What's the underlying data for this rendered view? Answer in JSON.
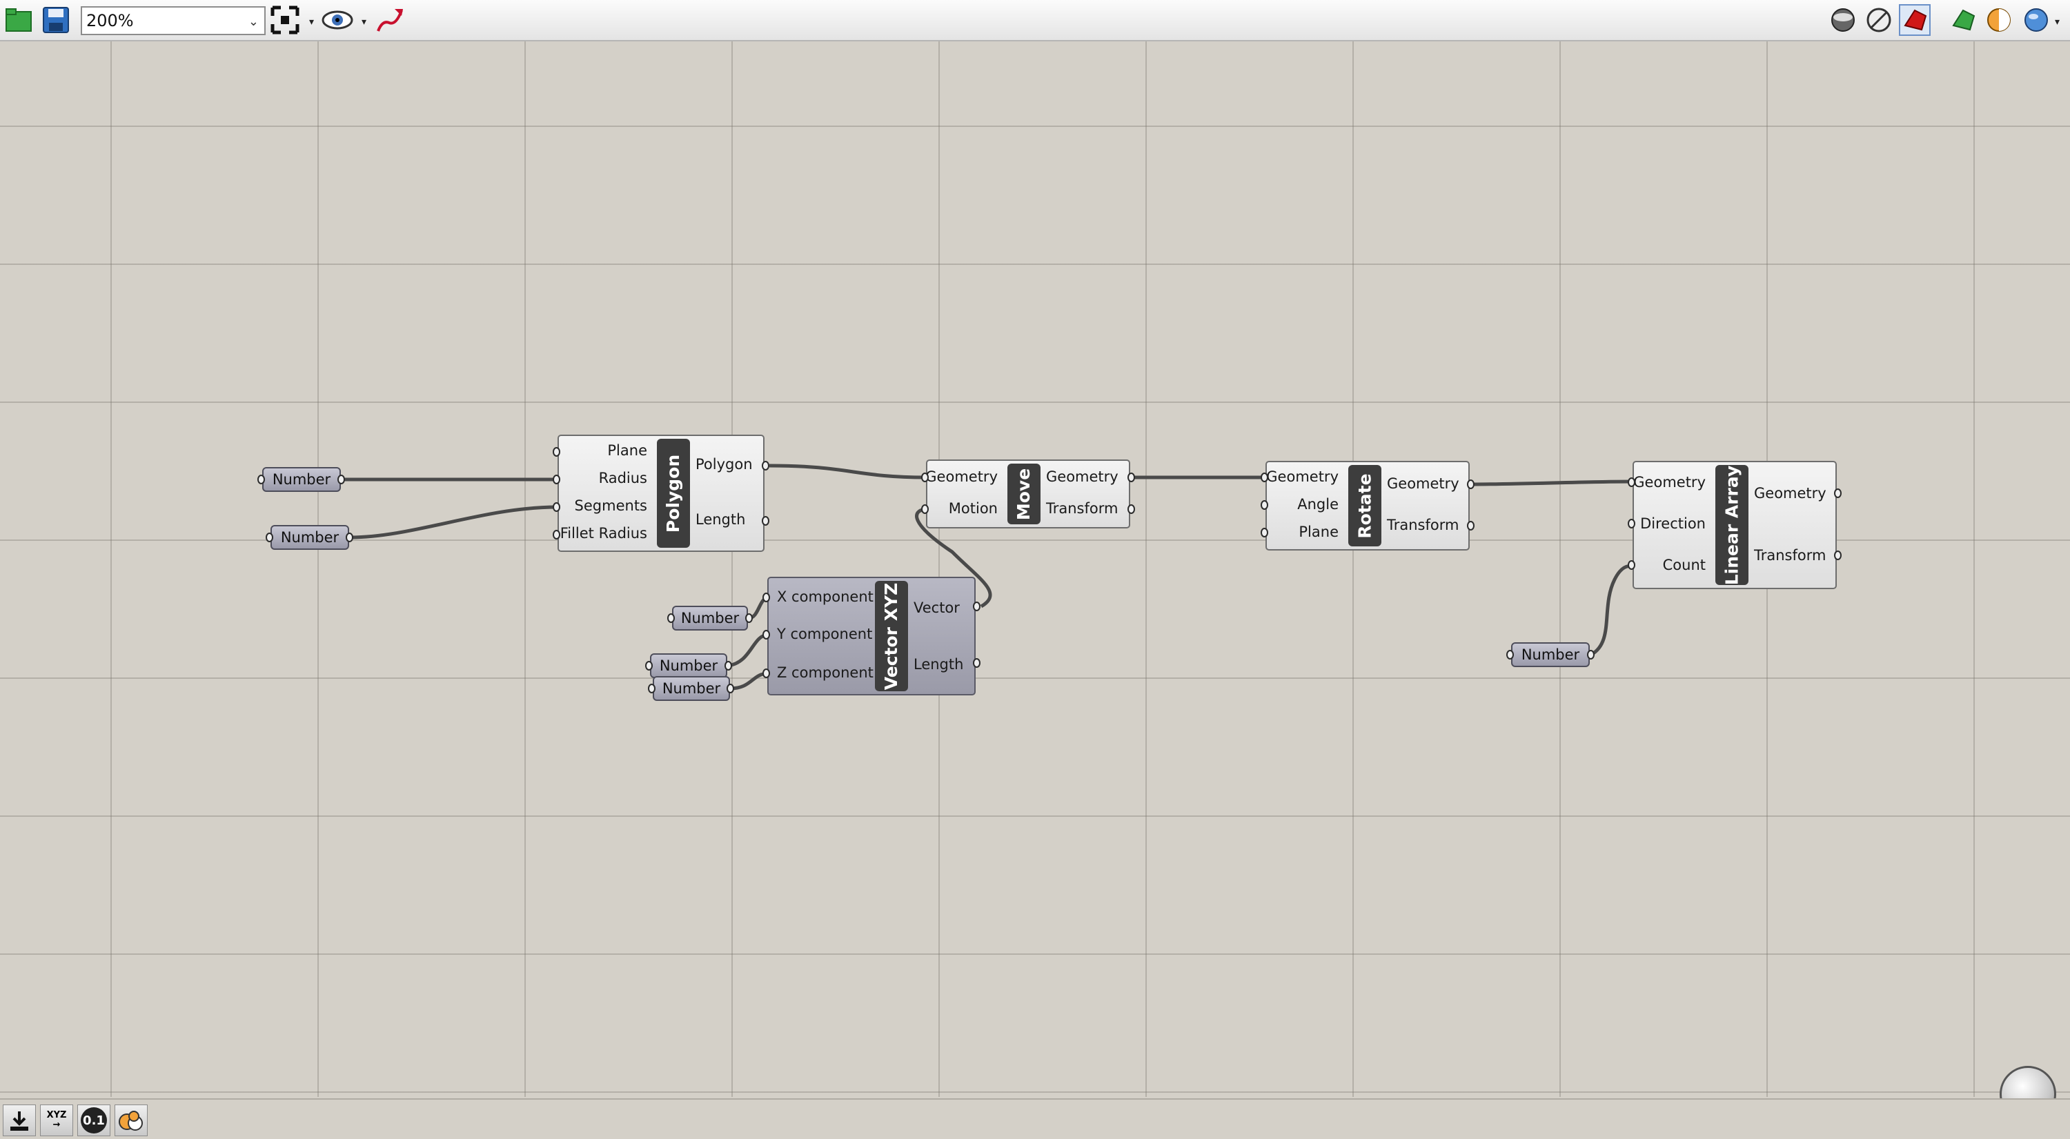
{
  "toolbar": {
    "zoom_value": "200%",
    "icons": [
      "open-file-icon",
      "save-file-icon",
      "zoom-extents-icon",
      "preview-eye-icon",
      "sketch-pen-icon",
      "wireframe-preview-icon",
      "no-preview-icon",
      "shaded-preview-icon",
      "preview-selected-icon",
      "document-preview-settings-icon",
      "mesh-quality-icon"
    ]
  },
  "components": {
    "polygon": {
      "name": "Polygon",
      "inputs": [
        "Plane",
        "Radius",
        "Segments",
        "Fillet Radius"
      ],
      "outputs": [
        "Polygon",
        "Length"
      ]
    },
    "move": {
      "name": "Move",
      "inputs": [
        "Geometry",
        "Motion"
      ],
      "outputs": [
        "Geometry",
        "Transform"
      ]
    },
    "rotate": {
      "name": "Rotate",
      "inputs": [
        "Geometry",
        "Angle",
        "Plane"
      ],
      "outputs": [
        "Geometry",
        "Transform"
      ]
    },
    "linear_array": {
      "name": "Linear Array",
      "inputs": [
        "Geometry",
        "Direction",
        "Count"
      ],
      "outputs": [
        "Geometry",
        "Transform"
      ]
    },
    "vector_xyz": {
      "name": "Vector XYZ",
      "inputs": [
        "X component",
        "Y component",
        "Z component"
      ],
      "outputs": [
        "Vector",
        "Length"
      ]
    }
  },
  "number_params": {
    "radius_number": "Number",
    "segments_number": "Number",
    "x_number": "Number",
    "y_number": "Number",
    "z_number": "Number",
    "count_number": "Number"
  },
  "statusbar": {
    "icons": [
      "bake-icon",
      "xyz-input-icon",
      "numeric-precision-icon",
      "cluster-icon"
    ],
    "xyz_text": "XYZ",
    "precision_text": "0.1"
  },
  "colors": {
    "canvas": "#d4d0c8",
    "wire": "#4a4a4a",
    "component_fill": "#e6e6e6",
    "param_fill": "#a8a8b8",
    "name_bar": "#3d3d3d"
  }
}
